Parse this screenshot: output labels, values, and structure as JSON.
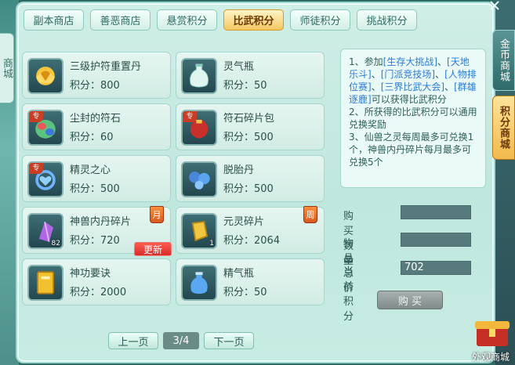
{
  "left_tab": "商城",
  "tabs": [
    "副本商店",
    "善恶商店",
    "悬赏积分",
    "比武积分",
    "师徒积分",
    "挑战积分"
  ],
  "active_tab": 3,
  "price_label": "积分：",
  "items": [
    {
      "name": "三级护符重置丹",
      "price": "800",
      "icon": "golden-charm-icon",
      "tag": "",
      "count": "",
      "flag": "",
      "update": ""
    },
    {
      "name": "灵气瓶",
      "price": "50",
      "icon": "spirit-vase-icon",
      "tag": "",
      "count": "",
      "flag": "",
      "update": ""
    },
    {
      "name": "尘封的符石",
      "price": "60",
      "icon": "rune-stone-icon",
      "tag": "专",
      "count": "",
      "flag": "",
      "update": ""
    },
    {
      "name": "符石碎片包",
      "price": "500",
      "icon": "red-pouch-icon",
      "tag": "专",
      "count": "",
      "flag": "",
      "update": ""
    },
    {
      "name": "精灵之心",
      "price": "500",
      "icon": "spirit-heart-icon",
      "tag": "专",
      "count": "",
      "flag": "",
      "update": ""
    },
    {
      "name": "脱胎丹",
      "price": "500",
      "icon": "blue-pill-icon",
      "tag": "",
      "count": "",
      "flag": "",
      "update": ""
    },
    {
      "name": "神兽内丹碎片",
      "price": "720",
      "icon": "purple-crystal-icon",
      "tag": "",
      "count": "82",
      "flag": "月",
      "update": "更新"
    },
    {
      "name": "元灵碎片",
      "price": "2064",
      "icon": "golden-shard-icon",
      "tag": "",
      "count": "1",
      "flag": "周",
      "update": ""
    },
    {
      "name": "神功要诀",
      "price": "2000",
      "icon": "golden-book-icon",
      "tag": "",
      "count": "",
      "flag": "",
      "update": ""
    },
    {
      "name": "精气瓶",
      "price": "50",
      "icon": "essence-bottle-icon",
      "tag": "",
      "count": "",
      "flag": "",
      "update": ""
    }
  ],
  "rules": {
    "line1_prefix": "1、参加",
    "links": [
      "[生存大挑战]",
      "[天地乐斗]",
      "[门派竞技场]",
      "[人物排位赛]",
      "[三界比武大会]",
      "[群雄逐鹿]"
    ],
    "sep": "、",
    "line1_suffix": "可以获得比武积分",
    "line2": "2、所获得的比武积分可以通用兑换奖励",
    "line3": "3、仙兽之灵每周最多可兑换1个，神兽内丹碎片每月最多可兑换5个"
  },
  "form": {
    "qty_label": "购买数量",
    "qty_value": "",
    "total_label": "物品总价",
    "total_value": "",
    "current_label": "当前积分",
    "current_value": "702",
    "buy_label": "购 买"
  },
  "pager": {
    "prev": "上一页",
    "page": "3/4",
    "next": "下一页"
  },
  "side_tabs": {
    "gold": "金币商城",
    "score": "积分商城"
  },
  "corner_label": "外观商城"
}
